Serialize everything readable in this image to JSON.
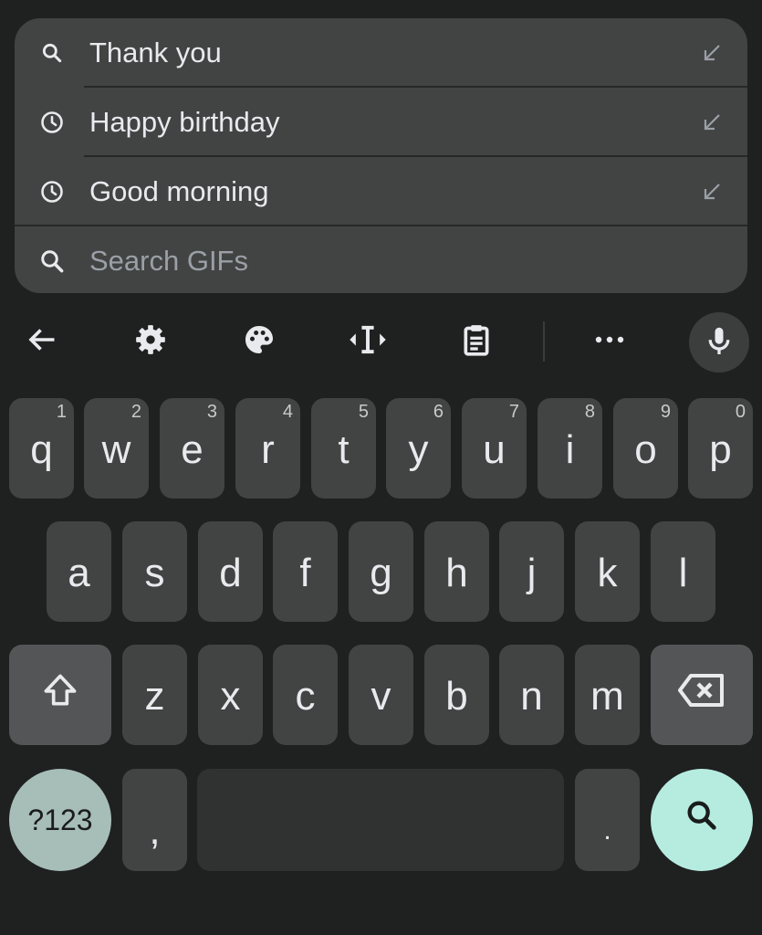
{
  "suggestions": [
    {
      "text": "Thank you",
      "lead_icon": "search-icon",
      "trail_icon": "insert-arrow-icon"
    },
    {
      "text": "Happy birthday",
      "lead_icon": "history-clock-icon",
      "trail_icon": "insert-arrow-icon"
    },
    {
      "text": "Good morning",
      "lead_icon": "history-clock-icon",
      "trail_icon": "insert-arrow-icon"
    }
  ],
  "search": {
    "placeholder": "Search GIFs",
    "icon": "search-icon"
  },
  "toolbar": {
    "items": [
      "back-arrow-icon",
      "gear-icon",
      "palette-icon",
      "text-cursor-icon",
      "clipboard-icon",
      "more-dots-icon",
      "mic-icon"
    ]
  },
  "keyboard": {
    "row1": [
      {
        "key": "q",
        "hint": "1"
      },
      {
        "key": "w",
        "hint": "2"
      },
      {
        "key": "e",
        "hint": "3"
      },
      {
        "key": "r",
        "hint": "4"
      },
      {
        "key": "t",
        "hint": "5"
      },
      {
        "key": "y",
        "hint": "6"
      },
      {
        "key": "u",
        "hint": "7"
      },
      {
        "key": "i",
        "hint": "8"
      },
      {
        "key": "o",
        "hint": "9"
      },
      {
        "key": "p",
        "hint": "0"
      }
    ],
    "row2": [
      "a",
      "s",
      "d",
      "f",
      "g",
      "h",
      "j",
      "k",
      "l"
    ],
    "row3": [
      "z",
      "x",
      "c",
      "v",
      "b",
      "n",
      "m"
    ],
    "symbols_label": "?123",
    "comma": ",",
    "period": ".",
    "shift_icon": "shift-icon",
    "backspace_icon": "backspace-icon",
    "enter_icon": "search-icon"
  },
  "colors": {
    "background": "#1f2020",
    "panel": "#424343",
    "key": "#424343",
    "mod_key": "#545556",
    "symbols_key": "#a7bdb8",
    "enter_key": "#b6ece0"
  }
}
